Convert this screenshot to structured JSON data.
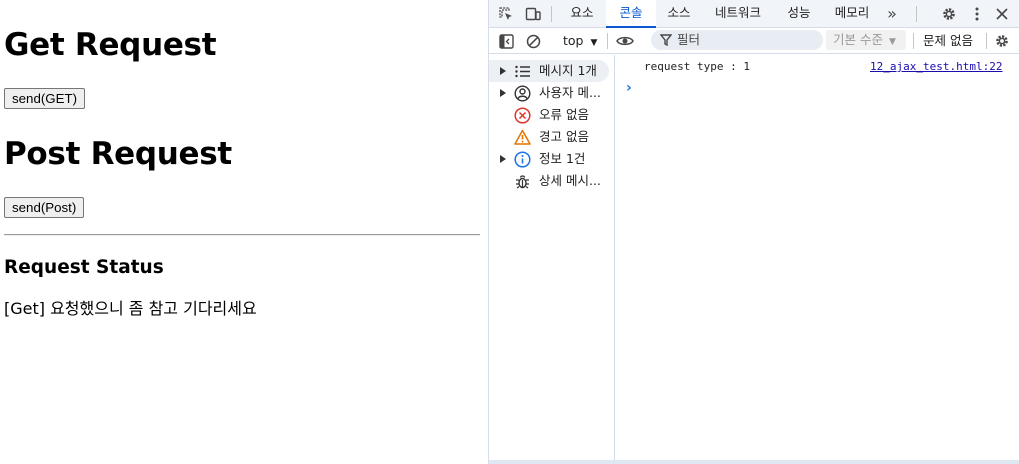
{
  "page": {
    "get_heading": "Get Request",
    "get_button": "send(GET)",
    "post_heading": "Post Request",
    "post_button": "send(Post)",
    "status_heading": "Request Status",
    "status_text": "[Get] 요청했으니 좀 참고 기다리세요"
  },
  "devtools": {
    "tabs": [
      {
        "label": "요소",
        "active": false
      },
      {
        "label": "콘솔",
        "active": true
      },
      {
        "label": "소스",
        "active": false
      },
      {
        "label": "네트워크",
        "active": false
      },
      {
        "label": "성능",
        "active": false
      },
      {
        "label": "메모리",
        "active": false
      }
    ],
    "toolbar": {
      "context": "top",
      "filter_placeholder": "필터",
      "log_level": "기본 수준",
      "issues": "문제 없음"
    },
    "sidebar": [
      {
        "label": "메시지 1개",
        "icon": "list-icon",
        "expandable": true,
        "selected": true
      },
      {
        "label": "사용자 메...",
        "icon": "user-icon",
        "expandable": true,
        "selected": false
      },
      {
        "label": "오류 없음",
        "icon": "error-icon",
        "expandable": false,
        "selected": false
      },
      {
        "label": "경고 없음",
        "icon": "warning-icon",
        "expandable": false,
        "selected": false
      },
      {
        "label": "정보 1건",
        "icon": "info-icon",
        "expandable": true,
        "selected": false
      },
      {
        "label": "상세 메시...",
        "icon": "bug-icon",
        "expandable": false,
        "selected": false
      }
    ],
    "console": {
      "message": "request type : 1",
      "source": "12_ajax_test.html:22"
    }
  },
  "colors": {
    "accent": "#0b57d0",
    "error": "#dc362e",
    "warning": "#e37400",
    "info": "#1a73e8"
  }
}
